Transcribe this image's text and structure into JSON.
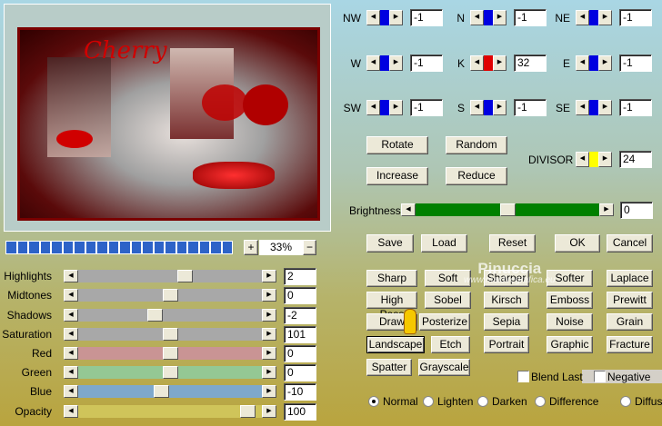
{
  "preview": {
    "title_text": "Cherry"
  },
  "zoom": {
    "plus": "+",
    "value": "33%",
    "minus": "−",
    "progress_segments": 20
  },
  "adjust": [
    {
      "label": "Highlights",
      "value": "2",
      "position": 0.59,
      "color": "#a8a8a8"
    },
    {
      "label": "Midtones",
      "value": "0",
      "position": 0.5,
      "color": "#a8a8a8"
    },
    {
      "label": "Shadows",
      "value": "-2",
      "position": 0.41,
      "color": "#a8a8a8"
    },
    {
      "label": "Saturation",
      "value": "101",
      "position": 0.5,
      "color": "#a8a8a8"
    },
    {
      "label": "Red",
      "value": "0",
      "position": 0.5,
      "color": "#c99494"
    },
    {
      "label": "Green",
      "value": "0",
      "position": 0.5,
      "color": "#94c894"
    },
    {
      "label": "Blue",
      "value": "-10",
      "position": 0.45,
      "color": "#7ea8cc"
    },
    {
      "label": "Opacity",
      "value": "100",
      "position": 0.96,
      "color": "#cfc45a"
    }
  ],
  "kernel": [
    {
      "label": "NW",
      "value": "-1",
      "color": "#0000e0"
    },
    {
      "label": "N",
      "value": "-1",
      "color": "#0000e0"
    },
    {
      "label": "NE",
      "value": "-1",
      "color": "#0000e0"
    },
    {
      "label": "W",
      "value": "-1",
      "color": "#0000e0"
    },
    {
      "label": "K",
      "value": "32",
      "color": "#e00000"
    },
    {
      "label": "E",
      "value": "-1",
      "color": "#0000e0"
    },
    {
      "label": "SW",
      "value": "-1",
      "color": "#0000e0"
    },
    {
      "label": "S",
      "value": "-1",
      "color": "#0000e0"
    },
    {
      "label": "SE",
      "value": "-1",
      "color": "#0000e0"
    }
  ],
  "buttons": {
    "rotate": "Rotate",
    "random": "Random",
    "increase": "Increase",
    "reduce": "Reduce",
    "save": "Save",
    "load": "Load",
    "reset": "Reset",
    "ok": "OK",
    "cancel": "Cancel"
  },
  "divisor": {
    "label": "DIVISOR",
    "value": "24",
    "color": "#ffff00"
  },
  "brightness": {
    "label": "Brightness",
    "value": "0",
    "position": 0.5,
    "color": "#008000"
  },
  "presets": [
    "Sharp",
    "Soft",
    "Sharper",
    "Softer",
    "Laplace",
    "High Pass",
    "Sobel",
    "Kirsch",
    "Emboss",
    "Prewitt",
    "Draw",
    "Posterize",
    "Sepia",
    "Noise",
    "Grain",
    "Landscape",
    "Etch",
    "Portrait",
    "Graphic",
    "Fracture",
    "Spatter",
    "Grayscale"
  ],
  "selected_preset": "Landscape",
  "checkboxes": {
    "blend_last": "Blend Last",
    "negative": "Negative"
  },
  "modes": {
    "options": [
      "Normal",
      "Lighten",
      "Darken",
      "Difference",
      "Diffuse"
    ],
    "selected": "Normal"
  },
  "watermark": {
    "name": "Pinuccia",
    "url": "www.maidiregrafica.eu"
  }
}
